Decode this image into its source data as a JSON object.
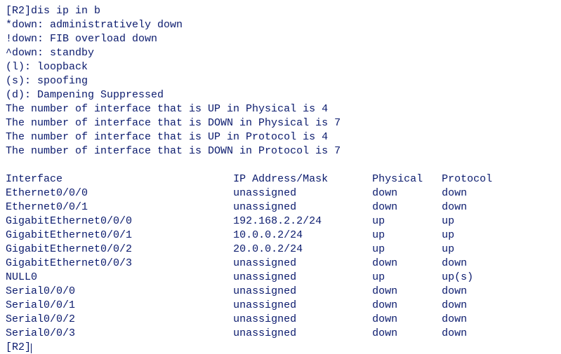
{
  "prompt_open": "[R2]",
  "command": "dis ip in b",
  "legend": [
    "*down: administratively down",
    "!down: FIB overload down",
    "^down: standby",
    "(l): loopback",
    "(s): spoofing",
    "(d): Dampening Suppressed"
  ],
  "counts": [
    "The number of interface that is UP in Physical is 4",
    "The number of interface that is DOWN in Physical is 7",
    "The number of interface that is UP in Protocol is 4",
    "The number of interface that is DOWN in Protocol is 7"
  ],
  "headers": {
    "interface": "Interface",
    "ip": "IP Address/Mask",
    "physical": "Physical",
    "protocol": "Protocol"
  },
  "rows": [
    {
      "interface": "Ethernet0/0/0",
      "ip": "unassigned",
      "physical": "down",
      "protocol": "down"
    },
    {
      "interface": "Ethernet0/0/1",
      "ip": "unassigned",
      "physical": "down",
      "protocol": "down"
    },
    {
      "interface": "GigabitEthernet0/0/0",
      "ip": "192.168.2.2/24",
      "physical": "up",
      "protocol": "up"
    },
    {
      "interface": "GigabitEthernet0/0/1",
      "ip": "10.0.0.2/24",
      "physical": "up",
      "protocol": "up"
    },
    {
      "interface": "GigabitEthernet0/0/2",
      "ip": "20.0.0.2/24",
      "physical": "up",
      "protocol": "up"
    },
    {
      "interface": "GigabitEthernet0/0/3",
      "ip": "unassigned",
      "physical": "down",
      "protocol": "down"
    },
    {
      "interface": "NULL0",
      "ip": "unassigned",
      "physical": "up",
      "protocol": "up(s)"
    },
    {
      "interface": "Serial0/0/0",
      "ip": "unassigned",
      "physical": "down",
      "protocol": "down"
    },
    {
      "interface": "Serial0/0/1",
      "ip": "unassigned",
      "physical": "down",
      "protocol": "down"
    },
    {
      "interface": "Serial0/0/2",
      "ip": "unassigned",
      "physical": "down",
      "protocol": "down"
    },
    {
      "interface": "Serial0/0/3",
      "ip": "unassigned",
      "physical": "down",
      "protocol": "down"
    }
  ],
  "prompt_close": "[R2]",
  "cols": {
    "c1": 36,
    "c2": 22,
    "c3": 11
  }
}
